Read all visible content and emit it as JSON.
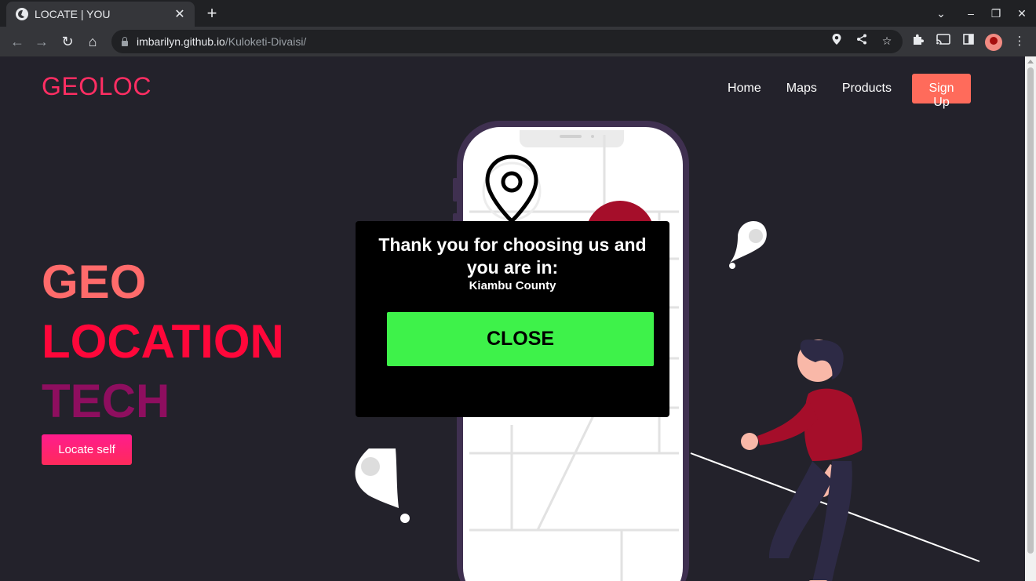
{
  "browser": {
    "tab_title": "LOCATE | YOU",
    "tab_close": "✕",
    "new_tab": "+",
    "url_host": "imbarilyn.github.io",
    "url_path": "/Kuloketi-Divaisi/"
  },
  "site": {
    "logo": "GEOLOC",
    "nav": [
      {
        "label": "Home"
      },
      {
        "label": "Maps"
      },
      {
        "label": "Products"
      },
      {
        "label": "Sign Up"
      }
    ],
    "hero": {
      "line1": "GEO",
      "line2": "LOCATION",
      "line3": "TECH"
    },
    "locate_button": "Locate self"
  },
  "modal": {
    "message": "Thank you for choosing us and you are in:",
    "location": "Kiambu County",
    "close_label": "CLOSE"
  },
  "colors": {
    "page_bg": "#23222b",
    "logo": "#ff2e63",
    "signup_bg": "#ff6b5b",
    "close_bg": "#3ef24a",
    "hero_geo": "#ff6b6b",
    "hero_location": "#ff073a",
    "hero_tech": "#8e0e5f",
    "person_shirt": "#a50e2a"
  }
}
